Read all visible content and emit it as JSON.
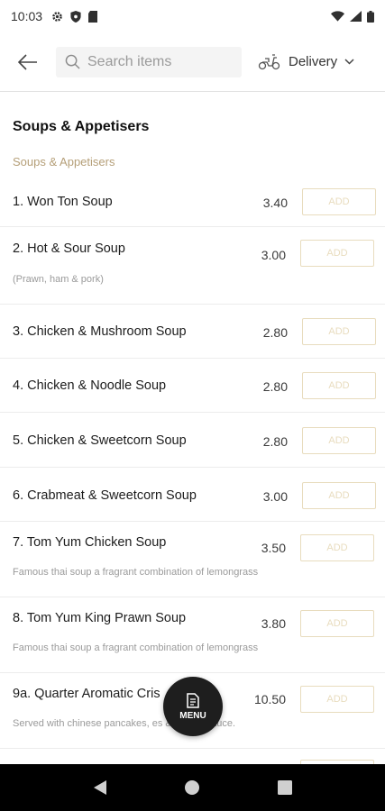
{
  "status_bar": {
    "time": "10:03"
  },
  "header": {
    "search_placeholder": "Search items",
    "delivery_label": "Delivery"
  },
  "section": {
    "title": "Soups & Appetisers",
    "subtitle": "Soups & Appetisers"
  },
  "items": [
    {
      "name": "1. Won Ton Soup",
      "price": "3.40",
      "desc": "",
      "add_label": "ADD"
    },
    {
      "name": "2. Hot & Sour Soup",
      "price": "3.00",
      "desc": "(Prawn, ham & pork)",
      "add_label": "ADD"
    },
    {
      "name": "3. Chicken & Mushroom Soup",
      "price": "2.80",
      "desc": "",
      "add_label": "ADD"
    },
    {
      "name": "4. Chicken & Noodle Soup",
      "price": "2.80",
      "desc": "",
      "add_label": "ADD"
    },
    {
      "name": "5. Chicken & Sweetcorn Soup",
      "price": "2.80",
      "desc": "",
      "add_label": "ADD"
    },
    {
      "name": "6. Crabmeat & Sweetcorn Soup",
      "price": "3.00",
      "desc": "",
      "add_label": "ADD"
    },
    {
      "name": "7. Tom Yum Chicken Soup",
      "price": "3.50",
      "desc": "Famous thai soup a fragrant combination of lemongrass",
      "add_label": "ADD"
    },
    {
      "name": "8. Tom Yum King Prawn Soup",
      "price": "3.80",
      "desc": "Famous thai soup a fragrant combination of lemongrass",
      "add_label": "ADD"
    },
    {
      "name": "9a. Quarter Aromatic Cris",
      "price": "10.50",
      "desc": "Served with chinese pancakes,                es & hoi sin sauce.",
      "add_label": "ADD"
    }
  ],
  "fab": {
    "label": "MENU"
  },
  "colors": {
    "accent": "#b59f78",
    "add_border": "#e8dcbe",
    "fab_bg": "#1e1e1e"
  }
}
